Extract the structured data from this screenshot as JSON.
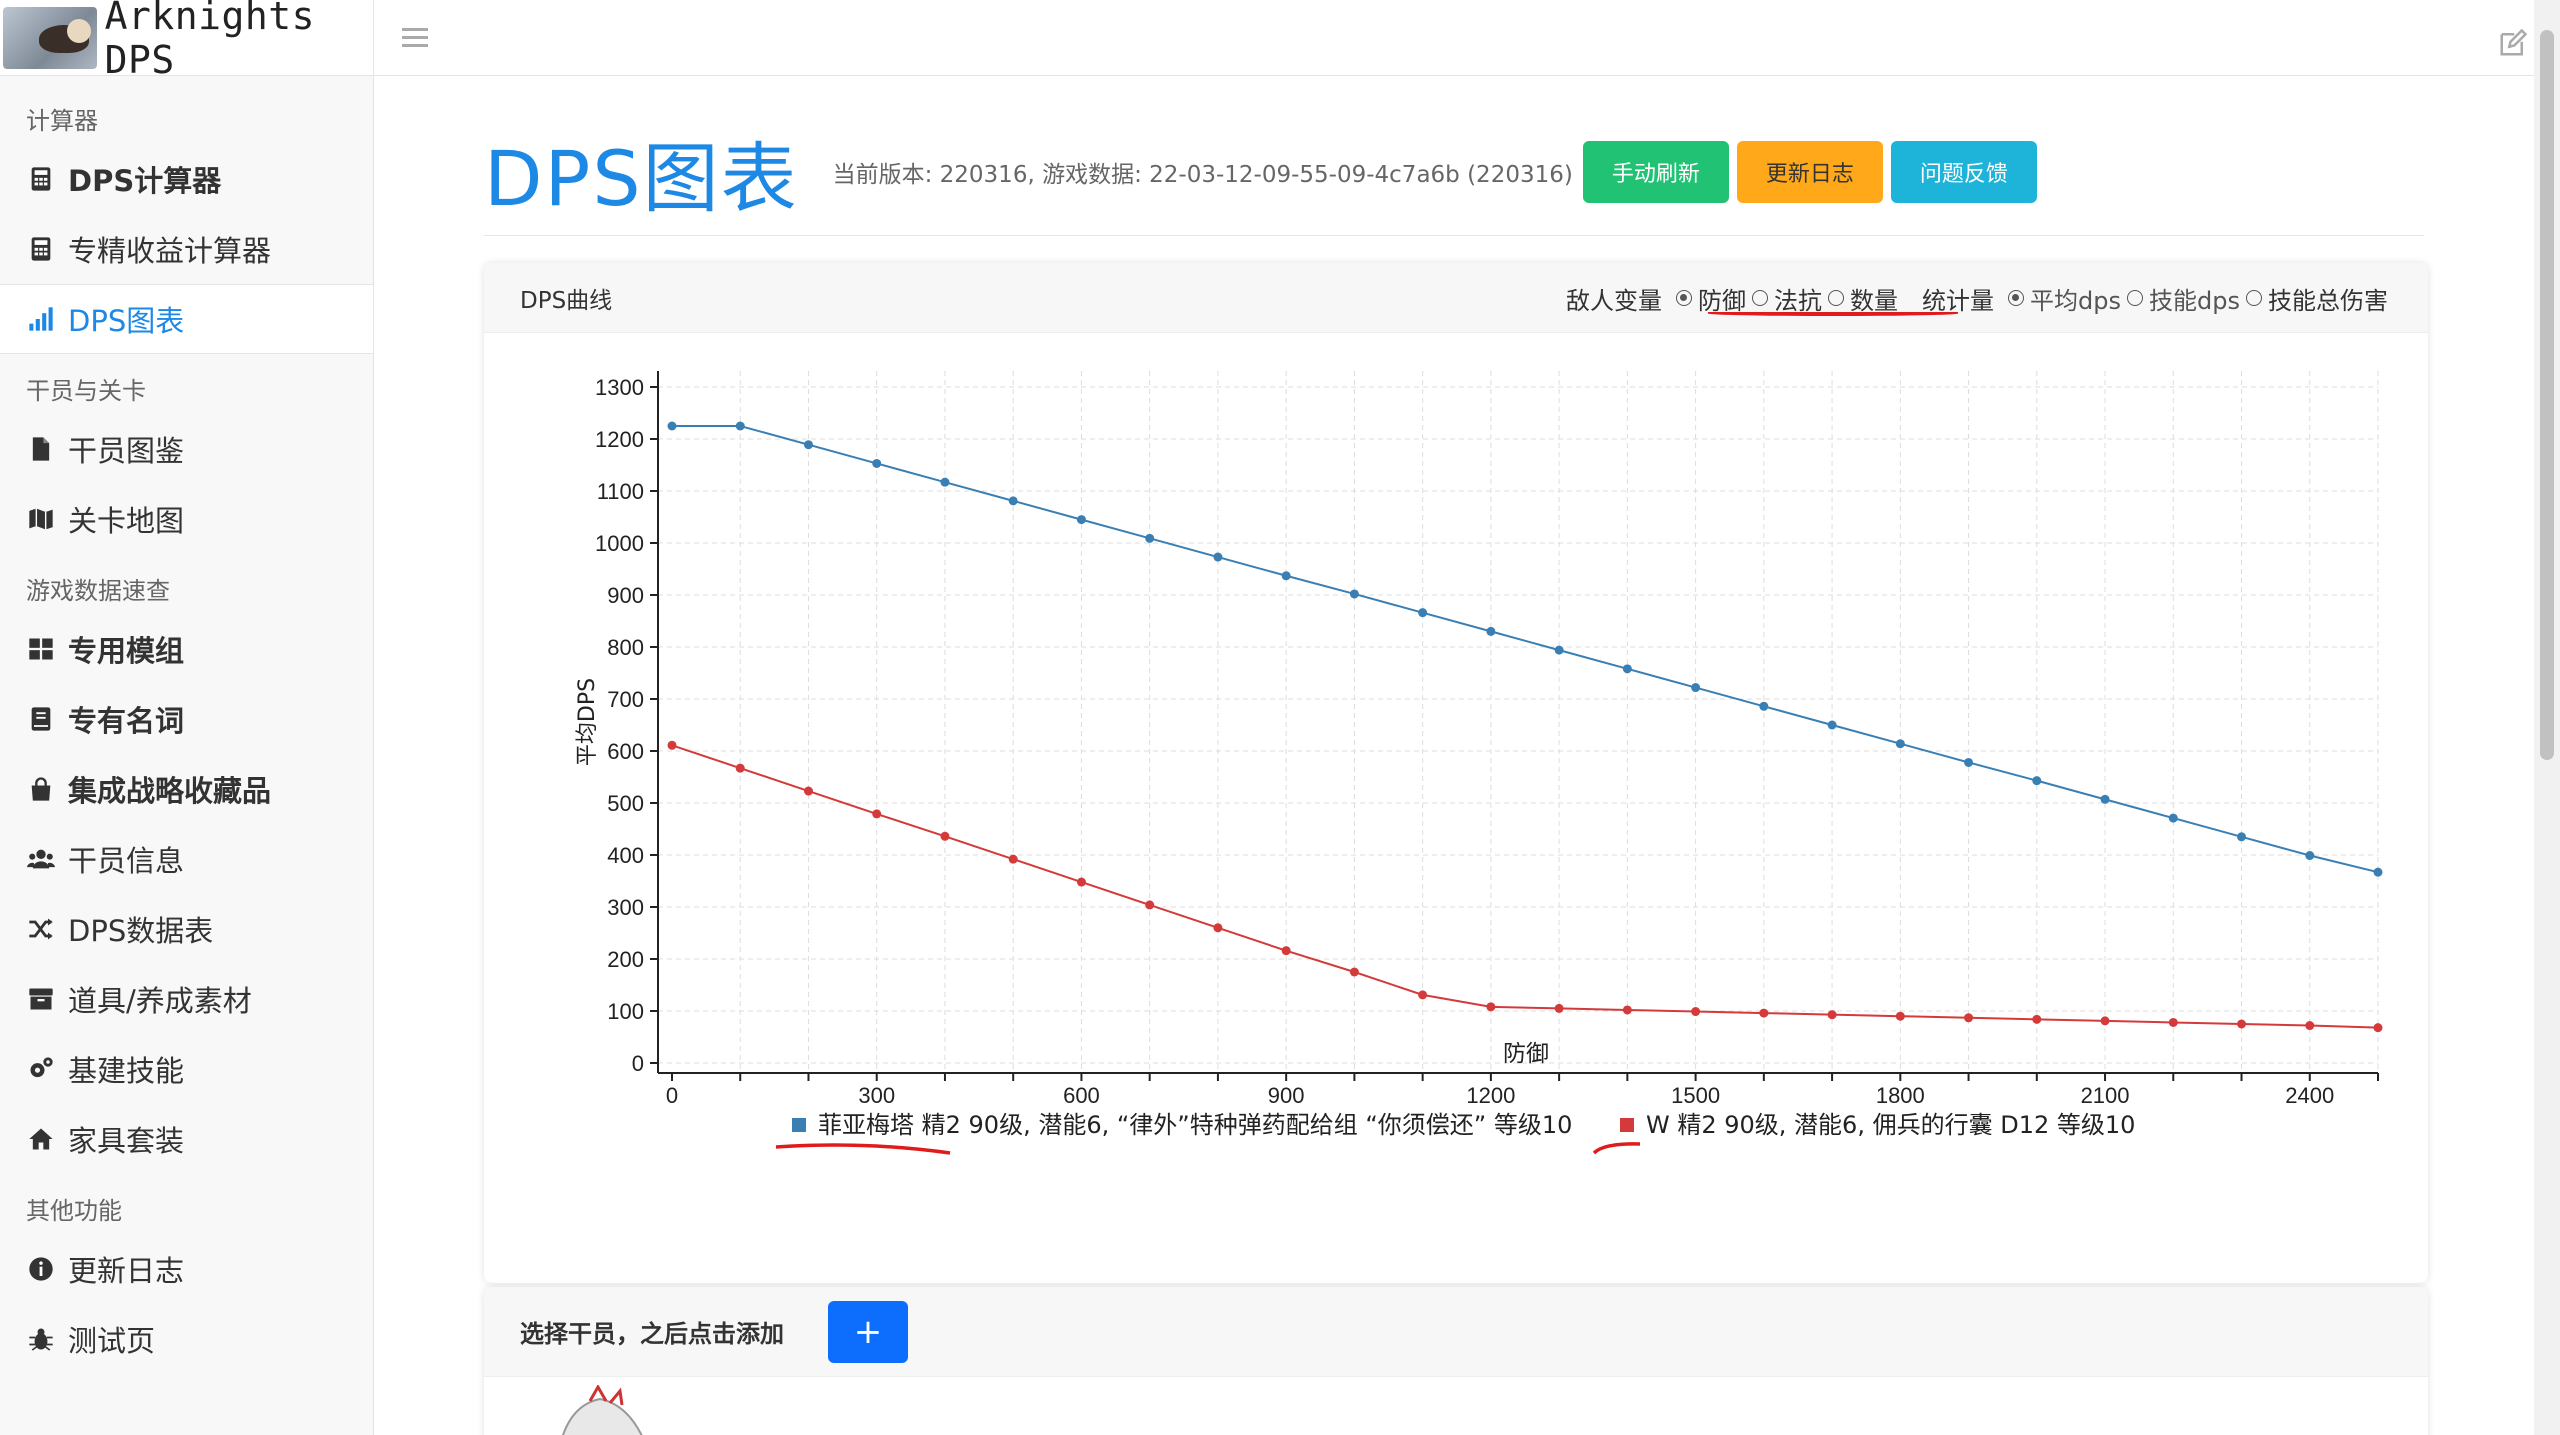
{
  "app": {
    "title": "Arknights DPS"
  },
  "sidebar": {
    "sections": [
      {
        "label": "计算器",
        "items": [
          {
            "label": "DPS计算器",
            "icon": "calculator-icon",
            "bold": true,
            "active": false
          },
          {
            "label": "专精收益计算器",
            "icon": "calculator-icon",
            "bold": false,
            "active": false
          },
          {
            "label": "DPS图表",
            "icon": "bar-signal-icon",
            "bold": false,
            "active": true
          }
        ]
      },
      {
        "label": "干员与关卡",
        "items": [
          {
            "label": "干员图鉴",
            "icon": "file-icon",
            "bold": false,
            "active": false
          },
          {
            "label": "关卡地图",
            "icon": "map-icon",
            "bold": false,
            "active": false
          }
        ]
      },
      {
        "label": "游戏数据速查",
        "items": [
          {
            "label": "专用模组",
            "icon": "grid-icon",
            "bold": true,
            "active": false
          },
          {
            "label": "专有名词",
            "icon": "book-icon",
            "bold": true,
            "active": false
          },
          {
            "label": "集成战略收藏品",
            "icon": "bag-icon",
            "bold": true,
            "active": false
          },
          {
            "label": "干员信息",
            "icon": "users-icon",
            "bold": false,
            "active": false
          },
          {
            "label": "DPS数据表",
            "icon": "shuffle-icon",
            "bold": false,
            "active": false
          },
          {
            "label": "道具/养成素材",
            "icon": "archive-icon",
            "bold": false,
            "active": false
          },
          {
            "label": "基建技能",
            "icon": "gears-icon",
            "bold": false,
            "active": false
          },
          {
            "label": "家具套装",
            "icon": "home-icon",
            "bold": false,
            "active": false
          }
        ]
      },
      {
        "label": "其他功能",
        "items": [
          {
            "label": "更新日志",
            "icon": "info-icon",
            "bold": false,
            "active": false
          },
          {
            "label": "测试页",
            "icon": "bug-icon",
            "bold": false,
            "active": false
          }
        ]
      }
    ]
  },
  "header": {
    "title": "DPS图表",
    "version": "当前版本: 220316, 游戏数据: 22-03-12-09-55-09-4c7a6b (220316)",
    "buttons": {
      "refresh": "手动刷新",
      "changelog": "更新日志",
      "feedback": "问题反馈"
    }
  },
  "chart_card": {
    "title": "DPS曲线",
    "enemy_var_label": "敌人变量",
    "enemy_options": [
      "防御",
      "法抗",
      "数量"
    ],
    "enemy_selected": "防御",
    "stat_label": "统计量",
    "stat_options": [
      "平均dps",
      "技能dps",
      "技能总伤害"
    ],
    "stat_selected": "平均dps"
  },
  "chart_data": {
    "type": "line",
    "xlabel": "防御",
    "ylabel": "平均DPS",
    "xlim": [
      0,
      2500
    ],
    "ylim": [
      0,
      1300
    ],
    "x_ticks": [
      0,
      300,
      600,
      900,
      1200,
      1500,
      1800,
      2100,
      2400
    ],
    "y_ticks": [
      0,
      100,
      200,
      300,
      400,
      500,
      600,
      700,
      800,
      900,
      1000,
      1100,
      1200,
      1300
    ],
    "grid": true,
    "legend_position": "bottom",
    "x": [
      0,
      100,
      200,
      300,
      400,
      500,
      600,
      700,
      800,
      900,
      1000,
      1100,
      1200,
      1300,
      1400,
      1500,
      1600,
      1700,
      1800,
      1900,
      2000,
      2100,
      2200,
      2300,
      2400,
      2500
    ],
    "series": [
      {
        "name": "菲亚梅塔 精2 90级, 潜能6, “律外”特种弹药配给组 “你须偿还” 等级10",
        "color": "#3a7fb4",
        "values": [
          1225,
          1225,
          1189,
          1153,
          1117,
          1081,
          1045,
          1009,
          973,
          937,
          902,
          866,
          830,
          794,
          758,
          722,
          686,
          650,
          614,
          578,
          543,
          507,
          471,
          435,
          399,
          367
        ]
      },
      {
        "name": "W 精2 90级, 潜能6, 佣兵的行囊 D12 等级10",
        "color": "#d43a3a",
        "values": [
          611,
          567,
          523,
          479,
          436,
          392,
          348,
          304,
          260,
          216,
          175,
          131,
          108,
          105,
          102,
          99,
          96,
          93,
          90,
          87,
          84,
          81,
          78,
          75,
          72,
          68
        ]
      }
    ]
  },
  "operator_card": {
    "title": "选择干员，之后点击添加",
    "add_label": "+"
  }
}
